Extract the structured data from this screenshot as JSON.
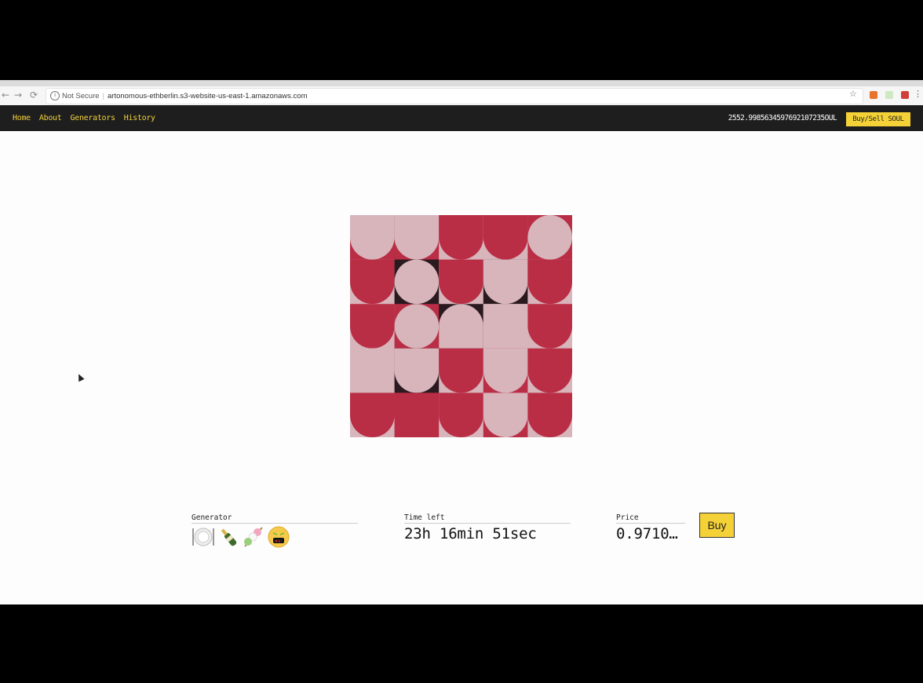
{
  "browser": {
    "security_label": "Not Secure",
    "url": "artonomous-ethberlin.s3-website-us-east-1.amazonaws.com",
    "info_glyph": "i",
    "back_icon": "←",
    "forward_icon": "→",
    "reload_icon": "⟳",
    "bookmark_icon": "☆",
    "menu_icon": "⋮"
  },
  "nav": {
    "links": [
      "Home",
      "About",
      "Generators",
      "History"
    ],
    "balance": "2552.9985634597692107235OUL",
    "buy_sell_label": "Buy/Sell SOUL",
    "accent_color": "#f4d137"
  },
  "artwork": {
    "colors": {
      "crimson": "#b92d45",
      "pink": "#d8b4bb",
      "dark": "#2a1a1f"
    }
  },
  "auction": {
    "generator_label": "Generator",
    "generator_emojis": [
      "plate-with-cutlery",
      "champagne-bottle",
      "dango",
      "face-with-symbols"
    ],
    "time_left_label": "Time left",
    "time_left_value": "23h 16min 51sec",
    "price_label": "Price",
    "price_value": "0.9710…",
    "buy_label": "Buy"
  }
}
